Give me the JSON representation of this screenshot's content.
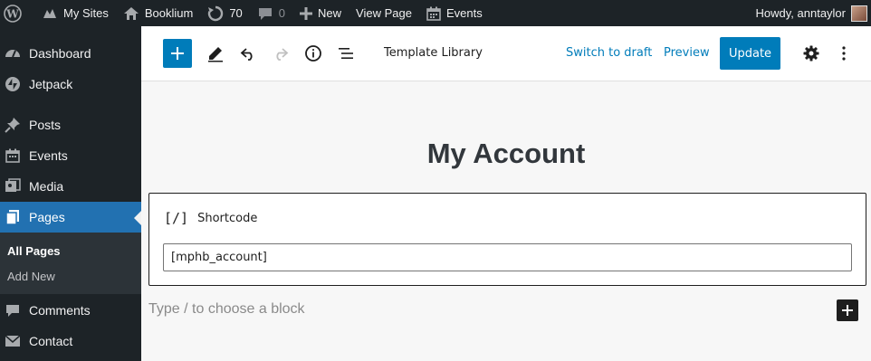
{
  "adminbar": {
    "my_sites": "My Sites",
    "site_name": "Booklium",
    "updates_count": "70",
    "comments_count": "0",
    "new_label": "New",
    "view_page": "View Page",
    "events": "Events",
    "howdy": "Howdy, anntaylor"
  },
  "sidebar": {
    "items": [
      {
        "label": "Dashboard",
        "icon": "dashboard-icon"
      },
      {
        "label": "Jetpack",
        "icon": "jetpack-icon"
      },
      {
        "label": "Posts",
        "icon": "pin-icon"
      },
      {
        "label": "Events",
        "icon": "calendar-icon"
      },
      {
        "label": "Media",
        "icon": "media-icon"
      },
      {
        "label": "Pages",
        "icon": "pages-icon"
      }
    ],
    "submenu": [
      "All Pages",
      "Add New"
    ],
    "bottom_items": [
      {
        "label": "Comments",
        "icon": "comment-icon"
      },
      {
        "label": "Contact",
        "icon": "mail-icon"
      }
    ]
  },
  "header": {
    "doc_title": "Template Library",
    "switch_to_draft": "Switch to draft",
    "preview": "Preview",
    "update": "Update"
  },
  "canvas": {
    "page_title": "My Account",
    "shortcode_block_title": "Shortcode",
    "shortcode_icon_glyph": "[/]",
    "shortcode_value": "[mphb_account]",
    "appender_placeholder": "Type / to choose a block"
  },
  "colors": {
    "admin_dark": "#1d2327",
    "accent": "#007cba",
    "current_menu": "#2271b1"
  }
}
